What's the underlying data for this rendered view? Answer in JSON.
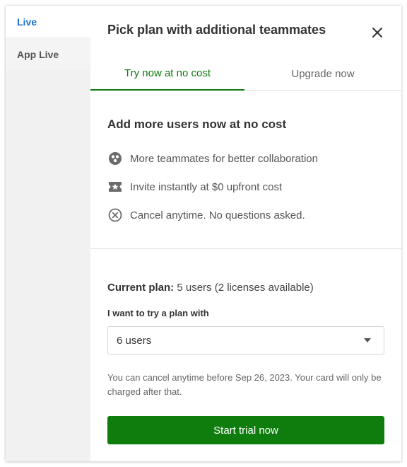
{
  "sidebar": {
    "items": [
      {
        "label": "Live"
      },
      {
        "label": "App Live"
      }
    ]
  },
  "dialog": {
    "title": "Pick plan with additional teammates",
    "close_icon": "close-icon"
  },
  "tabs": [
    {
      "label": "Try now at no cost",
      "active": true
    },
    {
      "label": "Upgrade now",
      "active": false
    }
  ],
  "section": {
    "title": "Add more users now at no cost",
    "features": [
      {
        "icon": "teammates-icon",
        "text": "More teammates for better collaboration"
      },
      {
        "icon": "ticket-star-icon",
        "text": "Invite instantly at $0 upfront cost"
      },
      {
        "icon": "cancel-circle-icon",
        "text": "Cancel anytime. No questions asked."
      }
    ]
  },
  "plan": {
    "current_label": "Current plan:",
    "current_value": "5 users (2 licenses available)",
    "try_label": "I want to try a plan with",
    "selected_option": "6 users",
    "note": "You can cancel anytime before Sep 26, 2023. Your card will only be charged after that.",
    "cta_label": "Start trial now"
  },
  "colors": {
    "accent_green": "#0e7d0e",
    "active_sidebar_blue": "#1a73c8"
  }
}
